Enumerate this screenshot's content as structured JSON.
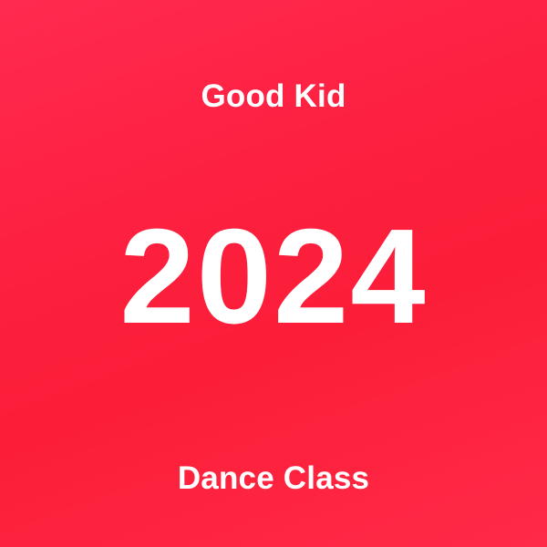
{
  "artwork": {
    "top_text": "Good Kid",
    "headline": "2024",
    "bottom_text": "Dance Class",
    "colors": {
      "background_start": "#ff2a50",
      "background_end": "#fc1e38",
      "text": "#ffffff"
    }
  }
}
